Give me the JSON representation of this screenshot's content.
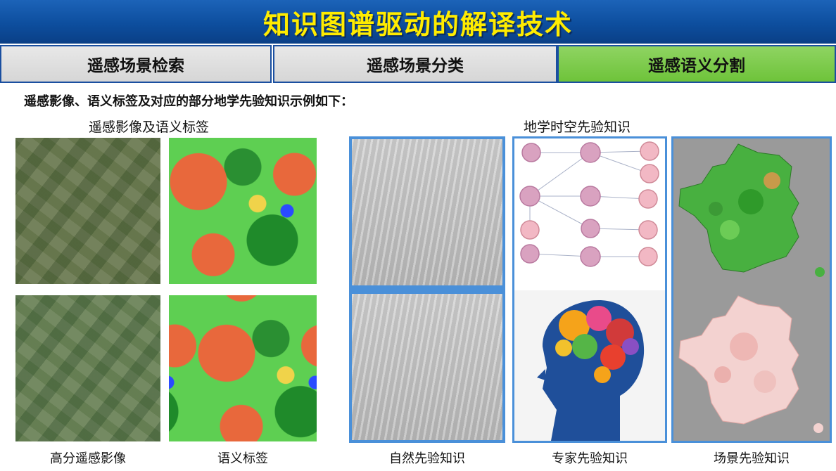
{
  "banner": {
    "title": "知识图谱驱动的解译技术"
  },
  "tabs": [
    {
      "label": "遥感场景检索"
    },
    {
      "label": "遥感场景分类"
    },
    {
      "label": "遥感语义分割"
    }
  ],
  "intro": "遥感影像、语义标签及对应的部分地学先验知识示例如下：",
  "sections": {
    "left_title": "遥感影像及语义标签",
    "right_title": "地学时空先验知识"
  },
  "captions": {
    "hr_image": "高分遥感影像",
    "semantic_label": "语义标签",
    "nature_knowledge": "自然先验知识",
    "expert_knowledge": "专家先验知识",
    "scene_knowledge": "场景先验知识"
  },
  "colors": {
    "banner_blue": "#0d4e9e",
    "title_yellow": "#ffec00",
    "active_tab_green": "#6ec33a",
    "frame_blue": "#4a90d9"
  }
}
